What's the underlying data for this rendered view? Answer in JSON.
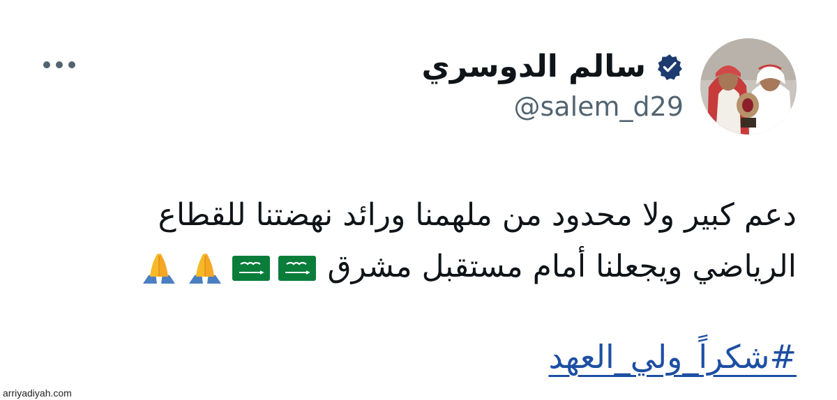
{
  "author": {
    "display_name": "سالم الدوسري",
    "handle": "@salem_d29",
    "verified_icon": "verified-badge-icon",
    "avatar_icon": "avatar-photo"
  },
  "menu": {
    "more_icon": "more-options-icon"
  },
  "tweet": {
    "line1": "دعم كبير ولا محدود من ملهمنا ورائد نهضتنا للقطاع",
    "line2": "الرياضي ويجعلنا أمام مستقبل مشرق",
    "emojis": [
      "saudi-flag",
      "saudi-flag",
      "folded-hands",
      "folded-hands"
    ],
    "hashtag": "#شكراً_ولي_العهد"
  },
  "watermark": "arriyadiyah.com",
  "colors": {
    "text": "#0f1419",
    "secondary": "#536471",
    "link": "#1d4fa3",
    "verified": "#1d3b6e",
    "flag_green": "#0a7d3b"
  }
}
